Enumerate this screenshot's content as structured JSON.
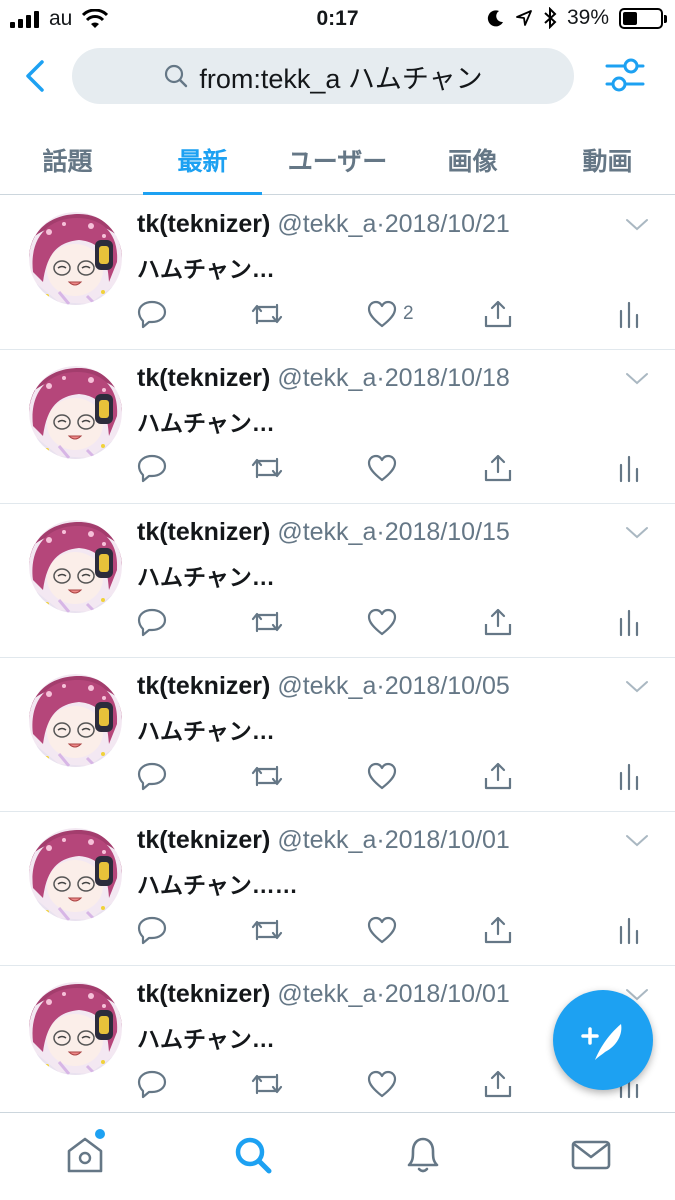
{
  "status_bar": {
    "carrier": "au",
    "time": "0:17",
    "battery": "39%",
    "battery_level": 0.39
  },
  "search": {
    "query": "from:tekk_a ハムチャン",
    "back_icon": "chevron-left-icon",
    "filter_icon": "sliders-icon"
  },
  "tabs": [
    {
      "label": "話題",
      "active": false
    },
    {
      "label": "最新",
      "active": true
    },
    {
      "label": "ユーザー",
      "active": false
    },
    {
      "label": "画像",
      "active": false
    },
    {
      "label": "動画",
      "active": false
    }
  ],
  "tweets": [
    {
      "name": "tk(teknizer)",
      "handle": "@tekk_a",
      "date": "2018/10/21",
      "text": "ハムチャン…",
      "likes": "2"
    },
    {
      "name": "tk(teknizer)",
      "handle": "@tekk_a",
      "date": "2018/10/18",
      "text": "ハムチャン…",
      "likes": ""
    },
    {
      "name": "tk(teknizer)",
      "handle": "@tekk_a",
      "date": "2018/10/15",
      "text": "ハムチャン…",
      "likes": ""
    },
    {
      "name": "tk(teknizer)",
      "handle": "@tekk_a",
      "date": "2018/10/05",
      "text": "ハムチャン…",
      "likes": ""
    },
    {
      "name": "tk(teknizer)",
      "handle": "@tekk_a",
      "date": "2018/10/01",
      "text": "ハムチャン……",
      "likes": ""
    },
    {
      "name": "tk(teknizer)",
      "handle": "@tekk_a",
      "date": "2018/10/01",
      "text": "ハムチャン…",
      "likes": ""
    }
  ],
  "bottom_nav": [
    {
      "icon": "home-icon",
      "active": false,
      "badge": true
    },
    {
      "icon": "search-icon",
      "active": true,
      "badge": false
    },
    {
      "icon": "bell-icon",
      "active": false,
      "badge": false
    },
    {
      "icon": "mail-icon",
      "active": false,
      "badge": false
    }
  ],
  "colors": {
    "accent": "#1da1f2",
    "text": "#14171a",
    "secondary": "#657786",
    "search_bg": "#e6ecf0"
  }
}
